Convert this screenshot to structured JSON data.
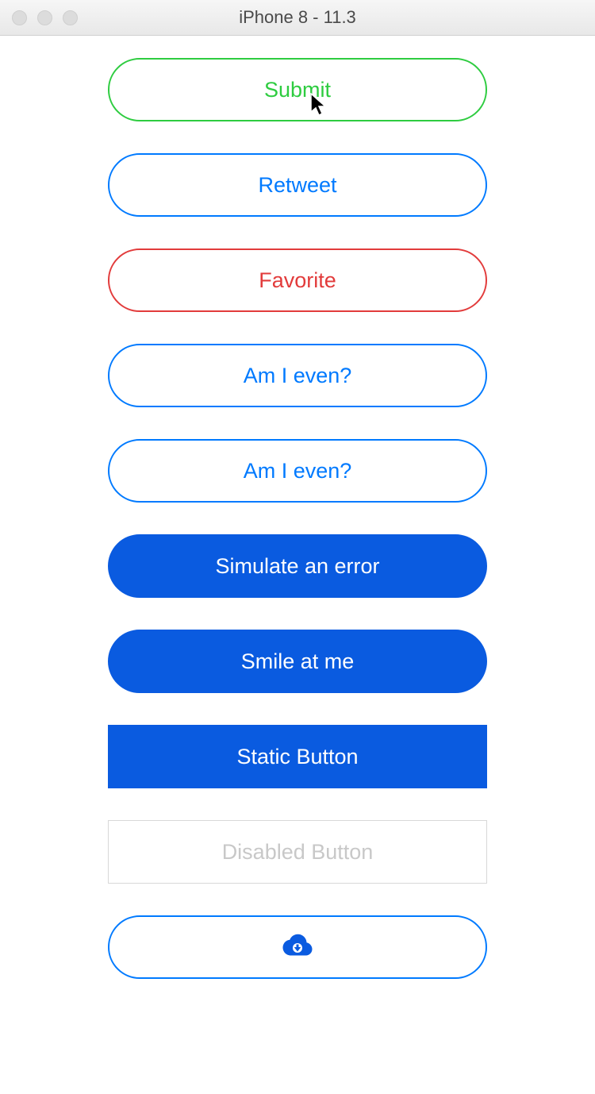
{
  "titlebar": {
    "title": "iPhone 8 - 11.3"
  },
  "buttons": {
    "submit": "Submit",
    "retweet": "Retweet",
    "favorite": "Favorite",
    "am_i_even_1": "Am I even?",
    "am_i_even_2": "Am I even?",
    "simulate_error": "Simulate an error",
    "smile": "Smile at me",
    "static": "Static Button",
    "disabled": "Disabled Button"
  },
  "colors": {
    "green": "#2ecc40",
    "blue": "#007aff",
    "filled_blue": "#0a5be0",
    "red": "#e23b3b",
    "disabled": "#c8c8c8"
  }
}
